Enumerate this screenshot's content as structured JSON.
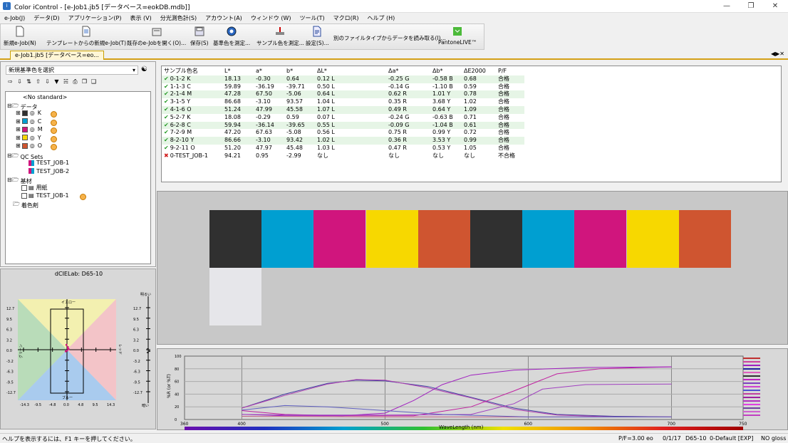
{
  "window": {
    "title": "Color iControl - [e-Job1.jb5 [データベース=eokDB.mdb]]",
    "icon": "app-icon"
  },
  "menu": [
    "e-Job(J)",
    "データ(D)",
    "アプリケーション(P)",
    "表示 (V)",
    "分光測色計(S)",
    "アカウント(A)",
    "ウィンドウ (W)",
    "ツール(T)",
    "マクロ(R)",
    "ヘルプ (H)"
  ],
  "toolbar": [
    {
      "label": "新規e-Job(N)",
      "icon": "new-document-icon"
    },
    {
      "label": "テンプレートからの新規e-Job(T)",
      "icon": "template-document-icon"
    },
    {
      "label": "既存のe-Jobを開く(O)...",
      "icon": "open-folder-icon"
    },
    {
      "label": "保存(S)",
      "icon": "save-icon"
    },
    {
      "label": "基準色を測定...",
      "icon": "measure-standard-icon"
    },
    {
      "label": "サンプル色を測定...",
      "icon": "measure-sample-icon"
    },
    {
      "label": "設定(S)...",
      "icon": "settings-document-icon"
    },
    {
      "label": "別のファイルタイプからデータを読み取る(I)...",
      "icon": ""
    },
    {
      "label": "PantoneLIVE™",
      "icon": "pantone-live-icon"
    }
  ],
  "tab": {
    "label": "e-Job1.jb5 [データベース=eo..."
  },
  "standard_select": {
    "value": "新規基準色を選択"
  },
  "tree": {
    "no_standard": "<No standard>",
    "data_folder": "データ",
    "data_items": [
      {
        "label": "K",
        "color": "#303030"
      },
      {
        "label": "C",
        "color": "#009fd1"
      },
      {
        "label": "M",
        "color": "#d0157d"
      },
      {
        "label": "Y",
        "color": "#f7d800"
      },
      {
        "label": "O",
        "color": "#cf5530"
      }
    ],
    "qc_folder": "QC Sets",
    "qc_items": [
      "TEST_JOB-1",
      "TEST_JOB-2"
    ],
    "substrate_folder": "基材",
    "substrate_items": [
      "用紙",
      "TEST_JOB-1"
    ],
    "colorant_folder": "着色剤"
  },
  "cielab": {
    "title": "dCIELab: D65-10",
    "top_label": "イエロー",
    "bottom_label": "ブルー",
    "left_label": "グリーン",
    "right_label": "レッド",
    "l_top": "明るい",
    "l_bottom": "暗い",
    "y_ticks": [
      "12.7",
      "9.5",
      "6.3",
      "3.2",
      "0.0",
      "-3.2",
      "-6.3",
      "-9.5",
      "-12.7"
    ],
    "x_ticks": [
      "-14.3",
      "-9.5",
      "-4.8",
      "0.0",
      "4.8",
      "9.5",
      "14.3"
    ],
    "colors": {
      "yellow": "#f3f0b0",
      "red": "#f3c4c8",
      "blue": "#a9cbee",
      "green": "#b9dcb9"
    }
  },
  "table": {
    "headers": [
      "サンプル色名",
      "L*",
      "a*",
      "b*",
      "ΔL*",
      "Δa*",
      "Δb*",
      "ΔE2000",
      "P/F"
    ],
    "rows": [
      {
        "status": "pass",
        "name": "0-1-2 K",
        "L": "18.13",
        "a": "-0.30",
        "b": "0.64",
        "dL": "0.12 L",
        "da": "-0.25 G",
        "db": "-0.58 B",
        "dE": "0.68",
        "pf": "合格"
      },
      {
        "status": "pass",
        "name": "1-1-3 C",
        "L": "59.89",
        "a": "-36.19",
        "b": "-39.71",
        "dL": "0.50 L",
        "da": "-0.14 G",
        "db": "-1.10 B",
        "dE": "0.59",
        "pf": "合格"
      },
      {
        "status": "pass",
        "name": "2-1-4 M",
        "L": "47.28",
        "a": "67.50",
        "b": "-5.06",
        "dL": "0.64 L",
        "da": "0.62 R",
        "db": "1.01 Y",
        "dE": "0.78",
        "pf": "合格"
      },
      {
        "status": "pass",
        "name": "3-1-5 Y",
        "L": "86.68",
        "a": "-3.10",
        "b": "93.57",
        "dL": "1.04 L",
        "da": "0.35 R",
        "db": "3.68 Y",
        "dE": "1.02",
        "pf": "合格"
      },
      {
        "status": "pass",
        "name": "4-1-6 O",
        "L": "51.24",
        "a": "47.99",
        "b": "45.58",
        "dL": "1.07 L",
        "da": "0.49 R",
        "db": "0.64 Y",
        "dE": "1.09",
        "pf": "合格"
      },
      {
        "status": "pass",
        "name": "5-2-7 K",
        "L": "18.08",
        "a": "-0.29",
        "b": "0.59",
        "dL": "0.07 L",
        "da": "-0.24 G",
        "db": "-0.63 B",
        "dE": "0.71",
        "pf": "合格"
      },
      {
        "status": "pass",
        "name": "6-2-8 C",
        "L": "59.94",
        "a": "-36.14",
        "b": "-39.65",
        "dL": "0.55 L",
        "da": "-0.09 G",
        "db": "-1.04 B",
        "dE": "0.61",
        "pf": "合格"
      },
      {
        "status": "pass",
        "name": "7-2-9 M",
        "L": "47.20",
        "a": "67.63",
        "b": "-5.08",
        "dL": "0.56 L",
        "da": "0.75 R",
        "db": "0.99 Y",
        "dE": "0.72",
        "pf": "合格"
      },
      {
        "status": "pass",
        "name": "8-2-10 Y",
        "L": "86.66",
        "a": "-3.10",
        "b": "93.42",
        "dL": "1.02 L",
        "da": "0.36 R",
        "db": "3.53 Y",
        "dE": "0.99",
        "pf": "合格"
      },
      {
        "status": "pass",
        "name": "9-2-11 O",
        "L": "51.20",
        "a": "47.97",
        "b": "45.48",
        "dL": "1.03 L",
        "da": "0.47 R",
        "db": "0.53 Y",
        "dE": "1.05",
        "pf": "合格"
      },
      {
        "status": "fail",
        "name": "0-TEST_JOB-1",
        "L": "94.21",
        "a": "0.95",
        "b": "-2.99",
        "dL": "なし",
        "da": "なし",
        "db": "なし",
        "dE": "なし",
        "pf": "不合格"
      }
    ]
  },
  "swatch_colors": [
    "#303030",
    "#009fd1",
    "#d0157d",
    "#f7d800",
    "#cf5530",
    "#303030",
    "#009fd1",
    "#d0157d",
    "#f7d800",
    "#cf5530",
    "#e6e6ea"
  ],
  "spectrum": {
    "xlabel": "WaveLength (nm)",
    "ylabel": "%R (or %T)",
    "x_ticks": [
      "360",
      "400",
      "500",
      "600",
      "700",
      "750"
    ],
    "y_ticks": [
      "100",
      "80",
      "60",
      "40",
      "20",
      "0"
    ]
  },
  "status": {
    "help": "ヘルプを表示するには、F1 キーを押してください。",
    "pf": "P/F=3.00",
    "user": "eo",
    "date": "0/1/17",
    "illum": "D65-10",
    "default": "0-Default [EXP]",
    "gloss": "NO gloss"
  }
}
